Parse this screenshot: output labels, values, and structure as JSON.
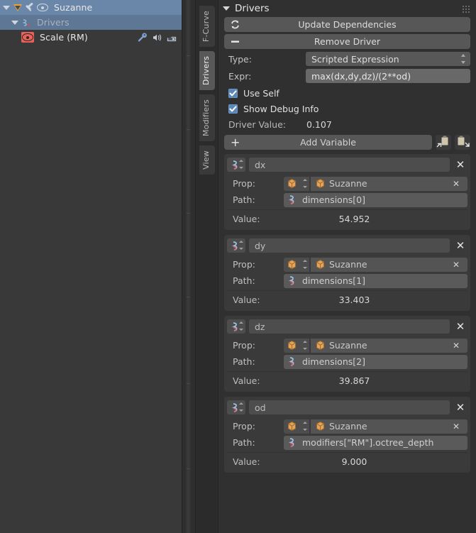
{
  "outliner": {
    "rows": [
      {
        "label": "Suzanne",
        "level": 0,
        "selected": true,
        "icons": [
          "disclosure-triangle",
          "mesh-data-icon",
          "pin-icon",
          "eye-icon"
        ]
      },
      {
        "label": "Drivers",
        "level": 1,
        "selected": true,
        "icons": [
          "disclosure-triangle",
          "driver-icon"
        ]
      },
      {
        "label": "Scale (RM)",
        "level": 2,
        "selected": false,
        "icons": [
          "eye-icon-red"
        ],
        "right_icons": [
          "wrench-icon",
          "speaker-icon",
          "render-icon"
        ]
      }
    ]
  },
  "tabs": [
    {
      "label": "F-Curve",
      "active": false
    },
    {
      "label": "Drivers",
      "active": true
    },
    {
      "label": "Modifiers",
      "active": false
    },
    {
      "label": "View",
      "active": false
    }
  ],
  "panel": {
    "title": "Drivers",
    "update_dependencies_label": "Update Dependencies",
    "remove_driver_label": "Remove Driver",
    "type_label": "Type:",
    "type_value": "Scripted Expression",
    "expr_label": "Expr:",
    "expr_value": "max(dx,dy,dz)/(2**od)",
    "use_self_label": "Use Self",
    "use_self_checked": true,
    "show_debug_label": "Show Debug Info",
    "show_debug_checked": true,
    "driver_value_label": "Driver Value:",
    "driver_value": "0.107",
    "add_variable_label": "Add Variable",
    "prop_label": "Prop:",
    "path_label": "Path:",
    "value_label": "Value:"
  },
  "variables": [
    {
      "name": "dx",
      "object": "Suzanne",
      "path": "dimensions[0]",
      "value": "54.952"
    },
    {
      "name": "dy",
      "object": "Suzanne",
      "path": "dimensions[1]",
      "value": "33.403"
    },
    {
      "name": "dz",
      "object": "Suzanne",
      "path": "dimensions[2]",
      "value": "39.867"
    },
    {
      "name": "od",
      "object": "Suzanne",
      "path": "modifiers[\"RM\"].octree_depth",
      "value": "9.000"
    }
  ],
  "colors": {
    "background": "#393939",
    "panel_bg": "#303030",
    "selection_blue": "#6a86a8",
    "checkbox_blue": "#5b86b8",
    "object_orange": "#e8a33d",
    "eye_red": "#e8625a"
  }
}
